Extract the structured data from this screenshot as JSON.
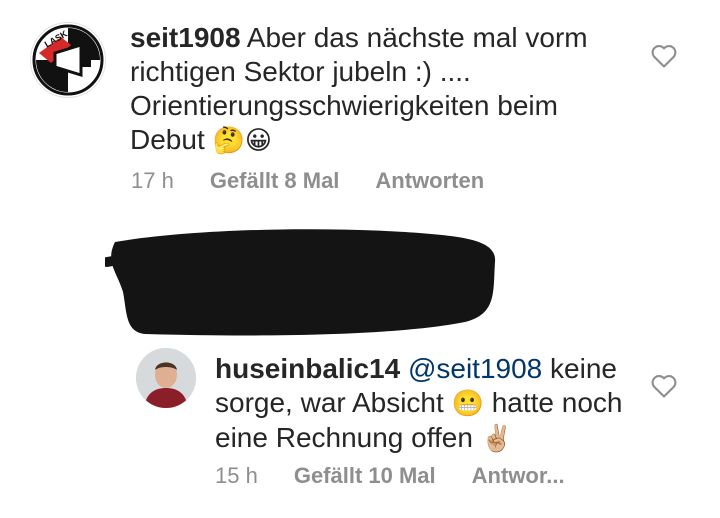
{
  "comments": [
    {
      "username": "seit1908",
      "text": "Aber das nächste mal vorm richtigen Sektor jubeln :) .... Orientierungsschwierigkeiten beim Debut",
      "emojis": [
        "🤔",
        "😀"
      ],
      "time": "17 h",
      "likes": "Gefällt 8 Mal",
      "reply": "Antworten",
      "avatar_icon": "lask-logo-icon",
      "avatar_text": "LASK"
    },
    {
      "username": "huseinbalic14",
      "mention": "@seit1908",
      "text_part1": "keine sorge, war Absicht",
      "emoji_mid": "😬",
      "text_part2": "hatte noch eine Rechnung offen",
      "emoji_end": "✌🏼",
      "time": "15 h",
      "likes": "Gefällt 10 Mal",
      "reply": "Antwor...",
      "avatar_icon": "user-photo-icon"
    }
  ],
  "colors": {
    "text": "#262626",
    "meta": "#8e8e8e",
    "mention": "#00376b",
    "redaction": "#141414"
  }
}
